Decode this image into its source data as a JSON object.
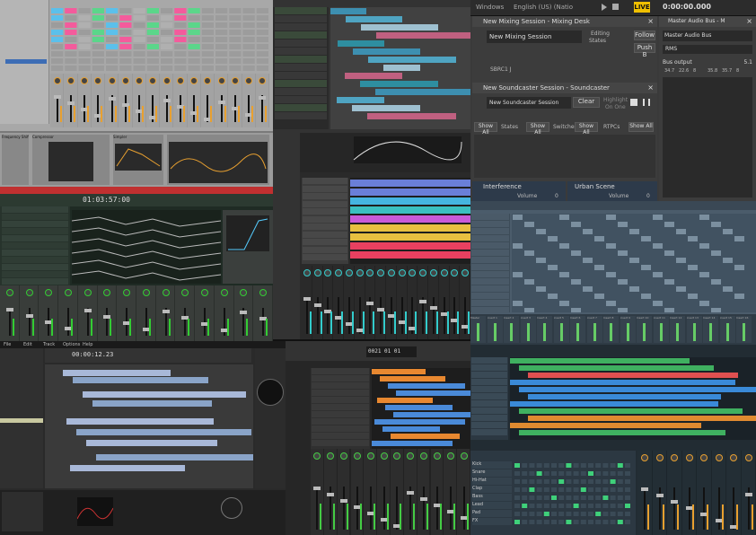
{
  "collage_title": "",
  "ableton": {
    "devices": [
      "Frequency Shifter",
      "Compressor",
      "Simpler"
    ]
  },
  "mixcraft": {
    "time": "01:03:57:00"
  },
  "reaper": {},
  "bitwig": {
    "transport": {
      "windows_label": "Windows",
      "language_label": "English (US) (Natio...",
      "time": "0:00:00.000",
      "live_label": "LIVE"
    },
    "mixing_session": {
      "title": "New Mixing Session - Mixing Desk",
      "name": "New Mixing Session",
      "editing_label": "Editing",
      "states_label": "States",
      "follow_label": "Follow",
      "push_label": "Push B",
      "readout": "SBRC1 J"
    },
    "soundcaster": {
      "title": "New Soundcaster Session - Soundcaster",
      "name": "New Soundcaster Session",
      "clear_label": "Clear",
      "highlight_label": "Highlight",
      "on_one_label": "On One",
      "show_all_1": "Show All",
      "states_label": "States",
      "show_all_2": "Show All",
      "switches_label": "Switches",
      "show_all_3": "Show All",
      "rtpcs_label": "RTPCs",
      "show_all_4": "Show All"
    },
    "bus": {
      "title": "Master Audio Bus - M",
      "name": "Master Audio Bus",
      "rms_label": "RMS",
      "bus_output_label": "Bus output",
      "output_value": "5.1",
      "scale": [
        "34.7",
        "22.6",
        "8",
        "35.8",
        "35.7",
        "8"
      ]
    },
    "interference": {
      "title": "Interference",
      "volume_label": "Volume",
      "volume_value": "0"
    },
    "urban": {
      "title": "Urban Scene",
      "volume_label": "Volume",
      "volume_value": "0"
    }
  },
  "fl": {
    "mixer_labels": [
      "Master",
      "Insert 1",
      "Insert 2",
      "Insert 3",
      "Insert 4",
      "Insert 5",
      "Insert 6",
      "Insert 7",
      "Insert 8",
      "Insert 9",
      "Insert 10",
      "Insert 11",
      "Insert 12",
      "Insert 13",
      "Insert 14",
      "Insert 15",
      "Insert 16"
    ]
  },
  "ardour": {
    "time": "00:00:12.23",
    "menu": [
      "File",
      "Edit",
      "Track",
      "Options",
      "Help"
    ]
  },
  "logic": {
    "lcd": "0021 01 01"
  },
  "lmms": {
    "instruments": [
      "Kick",
      "Snare",
      "Hi-Hat",
      "Clap",
      "Bass",
      "Lead",
      "Pad",
      "FX"
    ]
  },
  "colors": {
    "ableton_grey": "#a8a8a8",
    "mixcraft_dark": "#1f2b24",
    "reaper_teal": "#2e8ea0",
    "bitwig_grey": "#3a3a3a",
    "fl_blue": "#4b5c6b",
    "ardour_dark": "#2a2a2a",
    "logic_dark": "#262626",
    "lmms_dark": "#222c33",
    "accent_orange": "#e8a030",
    "live_yellow": "#f0c000"
  }
}
